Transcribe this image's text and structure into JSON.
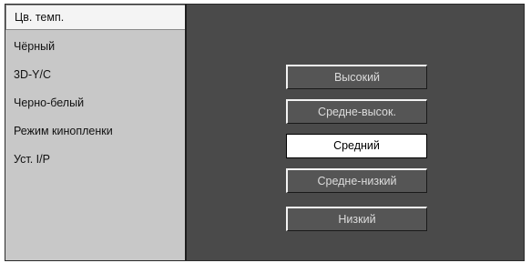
{
  "sidebar": {
    "items": [
      {
        "label": "Цв. темп."
      },
      {
        "label": "Чёрный"
      },
      {
        "label": "3D-Y/C"
      },
      {
        "label": "Черно-белый"
      },
      {
        "label": "Режим кинопленки"
      },
      {
        "label": "Уст. I/P"
      }
    ]
  },
  "options": {
    "items": [
      {
        "label": "Высокий"
      },
      {
        "label": "Средне-высок."
      },
      {
        "label": "Средний"
      },
      {
        "label": "Средне-низкий"
      },
      {
        "label": "Низкий"
      }
    ],
    "selected": "Средний"
  },
  "colors": {
    "panel_background": "#4a4a4a",
    "sidebar_background": "#c8c8c8",
    "option_background": "#555555",
    "selected_option_background": "#ffffff"
  }
}
